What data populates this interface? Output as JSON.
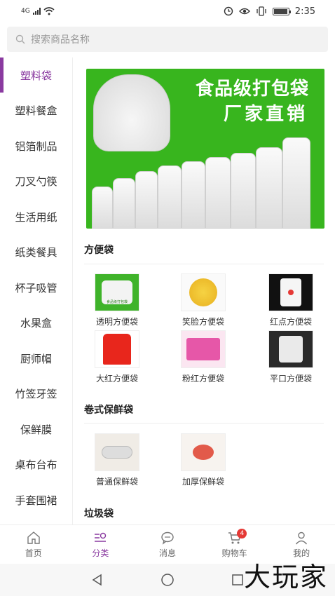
{
  "status_bar": {
    "network": "4G",
    "time": "2:35",
    "battery_level": 0.95
  },
  "search": {
    "placeholder": "搜索商品名称"
  },
  "sidebar": {
    "items": [
      {
        "label": "塑料袋",
        "active": true
      },
      {
        "label": "塑料餐盒"
      },
      {
        "label": "铝箔制品"
      },
      {
        "label": "刀叉勺筷"
      },
      {
        "label": "生活用纸"
      },
      {
        "label": "纸类餐具"
      },
      {
        "label": "杯子吸管"
      },
      {
        "label": "水果盒"
      },
      {
        "label": "厨师帽"
      },
      {
        "label": "竹签牙签"
      },
      {
        "label": "保鲜膜"
      },
      {
        "label": "桌布台布"
      },
      {
        "label": "手套围裙"
      }
    ]
  },
  "banner": {
    "line1": "食品级打包袋",
    "line2": "厂家直销"
  },
  "sections": [
    {
      "title": "方便袋",
      "products": [
        {
          "label": "透明方便袋",
          "thumb_text": "食品级打包袋",
          "icon": "clear-bag-thumb"
        },
        {
          "label": "笑脸方便袋",
          "icon": "smiley-bag-thumb"
        },
        {
          "label": "红点方便袋",
          "icon": "red-dot-bag-thumb"
        },
        {
          "label": "大红方便袋",
          "icon": "red-bag-thumb"
        },
        {
          "label": "粉红方便袋",
          "icon": "pink-bag-thumb"
        },
        {
          "label": "平口方便袋",
          "icon": "flat-bag-thumb"
        }
      ]
    },
    {
      "title": "卷式保鲜袋",
      "products": [
        {
          "label": "普通保鲜袋",
          "icon": "roll-bag-thumb"
        },
        {
          "label": "加厚保鲜袋",
          "icon": "thick-bag-thumb"
        }
      ]
    },
    {
      "title": "垃圾袋",
      "products": []
    }
  ],
  "tabbar": {
    "tabs": [
      {
        "label": "首页",
        "icon": "home-icon"
      },
      {
        "label": "分类",
        "icon": "category-icon",
        "active": true
      },
      {
        "label": "消息",
        "icon": "message-icon"
      },
      {
        "label": "购物车",
        "icon": "cart-icon",
        "badge": "4"
      },
      {
        "label": "我的",
        "icon": "user-icon"
      }
    ]
  },
  "watermark": "大玩家",
  "colors": {
    "accent": "#8a3aa0",
    "banner_green": "#38b51e",
    "badge_red": "#e53935"
  }
}
